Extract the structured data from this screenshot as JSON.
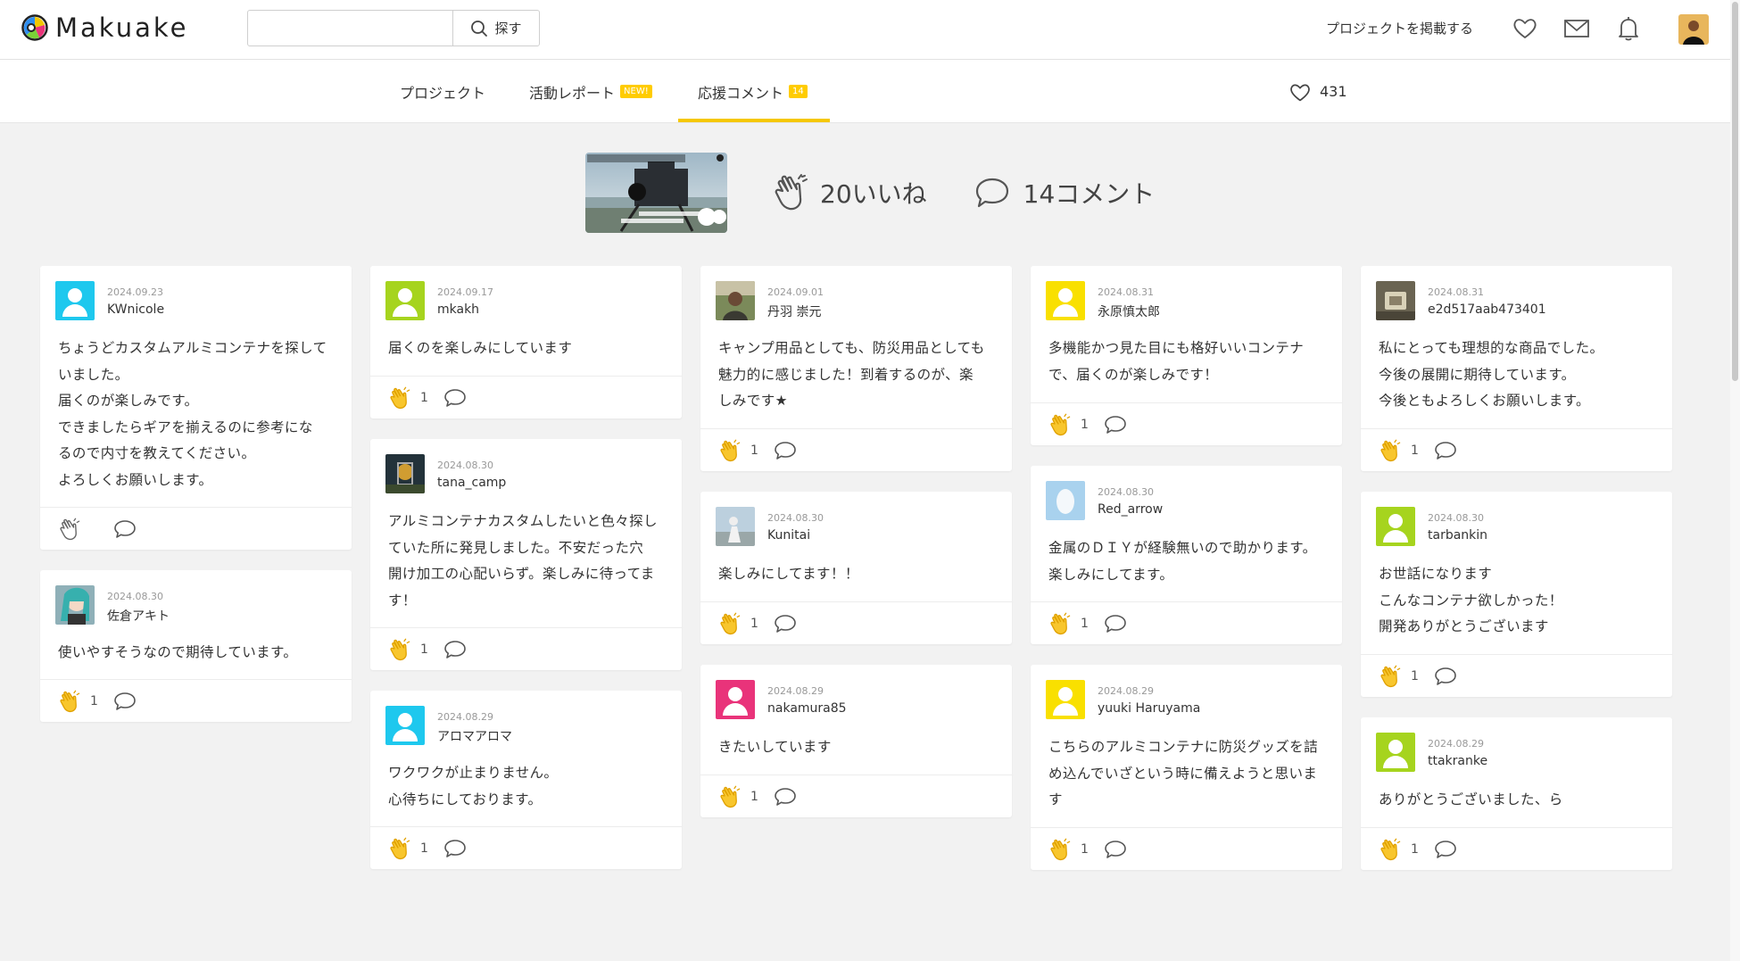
{
  "brand": {
    "name": "Makuake"
  },
  "search": {
    "placeholder": "",
    "button_label": "探す"
  },
  "header": {
    "post_project_label": "プロジェクトを掲載する"
  },
  "tabs": [
    {
      "label": "プロジェクト",
      "badge": ""
    },
    {
      "label": "活動レポート",
      "badge": "NEW!"
    },
    {
      "label": "応援コメント",
      "badge": "14"
    }
  ],
  "favorites": {
    "count": "431"
  },
  "summary": {
    "likes_label": "20いいね",
    "comments_label": "14コメント"
  },
  "colors": {
    "accent": "#f5c800",
    "clap": "#f6b800",
    "avatar_cyan": "#1ec8ee",
    "avatar_lime": "#a6d41e",
    "avatar_yellow": "#f9e000",
    "avatar_pink": "#e9337a"
  },
  "comments": [
    {
      "date": "2024.09.23",
      "user": "KWnicole",
      "avatar": "cyan",
      "text": "ちょうどカスタムアルミコンテナを探して\nいました。\n届くのが楽しみです。\nできましたらギアを揃えるのに参考にな\nるので内寸を教えてください。\nよろしくお願いします。",
      "likes": ""
    },
    {
      "date": "2024.08.30",
      "user": "佐倉アキト",
      "avatar": "photo-anime",
      "text": "使いやすそうなので期待しています。",
      "likes": "1"
    },
    {
      "date": "2024.09.17",
      "user": "mkakh",
      "avatar": "lime",
      "text": "届くのを楽しみにしています",
      "likes": "1"
    },
    {
      "date": "2024.08.30",
      "user": "tana_camp",
      "avatar": "photo-lantern",
      "text": "アルミコンテナカスタムしたいと色々探し\nていた所に発見しました。不安だった穴\n開け加工の心配いらず。楽しみに待ってま\nす！",
      "likes": "1"
    },
    {
      "date": "2024.08.29",
      "user": "アロマアロマ",
      "avatar": "cyan",
      "text": "ワクワクが止まりません。\n心待ちにしております。",
      "likes": "1"
    },
    {
      "date": "2024.09.01",
      "user": "丹羽 崇元",
      "avatar": "photo-man",
      "text": "キャンプ用品としても、防災用品としても\n魅力的に感じました！到着するのが、楽\nしみです★",
      "likes": "1"
    },
    {
      "date": "2024.08.30",
      "user": "Kunitai",
      "avatar": "photo-outdoor",
      "text": "楽しみにしてます！！",
      "likes": "1"
    },
    {
      "date": "2024.08.29",
      "user": "nakamura85",
      "avatar": "pink",
      "text": "きたいしています",
      "likes": "1"
    },
    {
      "date": "2024.08.31",
      "user": "永原慎太郎",
      "avatar": "yellow",
      "text": "多機能かつ見た目にも格好いいコンテナ\nで、届くのが楽しみです！",
      "likes": "1"
    },
    {
      "date": "2024.08.30",
      "user": "Red_arrow",
      "avatar": "photo-egg",
      "text": "金属のＤＩＹが経験無いので助かります。\n楽しみにしてます。",
      "likes": "1"
    },
    {
      "date": "2024.08.29",
      "user": "yuuki Haruyama",
      "avatar": "yellow",
      "text": "こちらのアルミコンテナに防災グッズを詰\nめ込んでいざという時に備えようと思いま\nす",
      "likes": "1"
    },
    {
      "date": "2024.08.31",
      "user": "e2d517aab473401",
      "avatar": "photo-gear",
      "text": "私にとっても理想的な商品でした。\n今後の展開に期待しています。\n今後ともよろしくお願いします。",
      "likes": "1"
    },
    {
      "date": "2024.08.30",
      "user": "tarbankin",
      "avatar": "lime",
      "text": "お世話になります\nこんなコンテナ欲しかった！\n開発ありがとうございます",
      "likes": "1"
    },
    {
      "date": "2024.08.29",
      "user": "ttakranke",
      "avatar": "lime",
      "text": "ありがとうございました、ら",
      "likes": "1"
    }
  ]
}
